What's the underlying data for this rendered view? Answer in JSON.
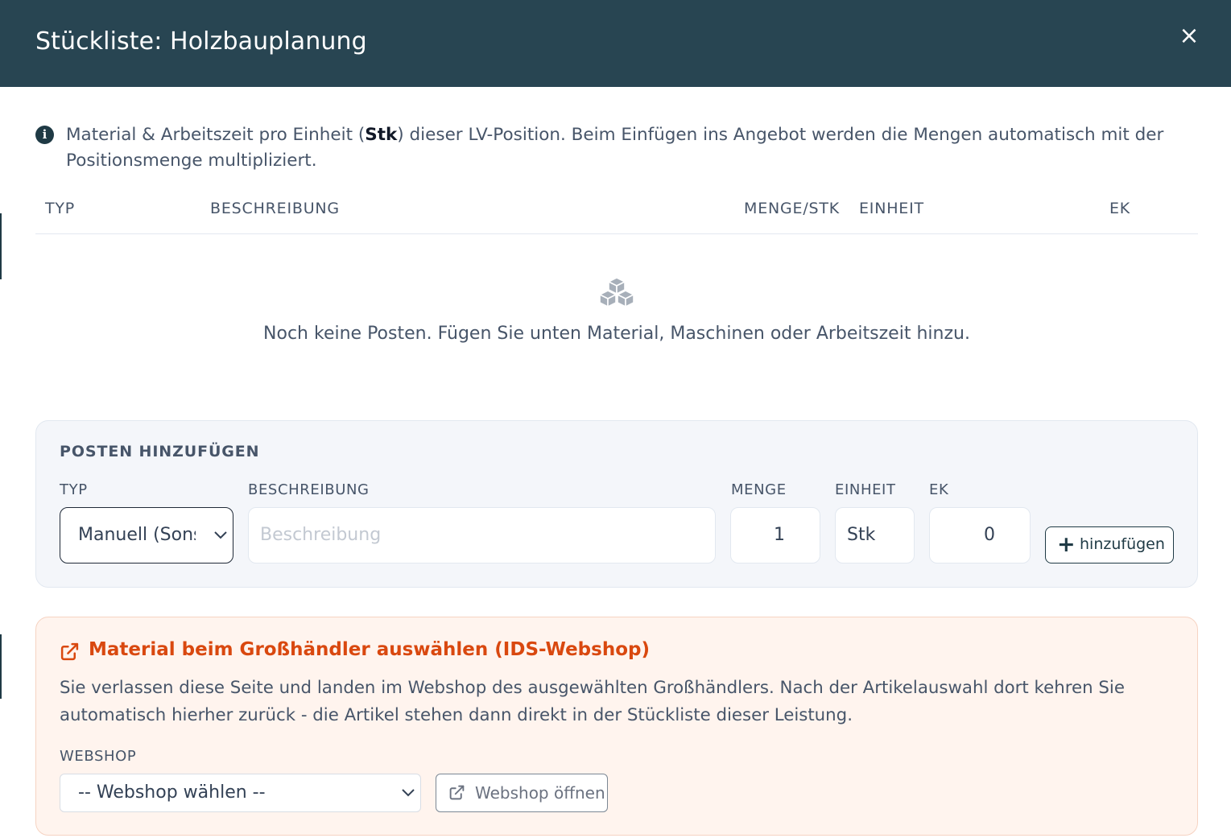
{
  "modal": {
    "title": "Stückliste: Holzbauplanung",
    "close_label": "×"
  },
  "info": {
    "text_before": "Material & Arbeitszeit pro Einheit (",
    "unit": "Stk",
    "text_after": ") dieser LV-Position. Beim Einfügen ins Angebot werden die Mengen automatisch mit der Positionsmenge multipliziert."
  },
  "table": {
    "columns": [
      "TYP",
      "BESCHREIBUNG",
      "MENGE/STK",
      "EINHEIT",
      "EK"
    ],
    "empty_message": "Noch keine Posten. Fügen Sie unten Material, Maschinen oder Arbeitszeit hinzu.",
    "empty_icon": "cubes-icon"
  },
  "add_form": {
    "title": "POSTEN HINZUFÜGEN",
    "labels": {
      "typ": "TYP",
      "beschreibung": "BESCHREIBUNG",
      "menge": "MENGE",
      "einheit": "EINHEIT",
      "ek": "EK"
    },
    "typ_value": "Manuell (Sonstiges)",
    "beschreibung_placeholder": "Beschreibung",
    "menge_value": "1",
    "einheit_value": "Stk",
    "ek_value": "0",
    "add_button": "hinzufügen"
  },
  "webshop": {
    "title": "Material beim Großhändler auswählen (IDS-Webshop)",
    "description": "Sie verlassen diese Seite und landen im Webshop des ausgewählten Großhändlers. Nach der Artikelauswahl dort kehren Sie automatisch hierher zurück - die Artikel stehen dann direkt in der Stückliste dieser Leistung.",
    "label": "WEBSHOP",
    "select_value": "-- Webshop wählen --",
    "open_button": "Webshop öffnen"
  },
  "colors": {
    "header_bg": "#284552",
    "accent_orange": "#d9480f",
    "panel_bg": "#f4f6fa",
    "shop_panel_bg": "#fff4ee"
  }
}
